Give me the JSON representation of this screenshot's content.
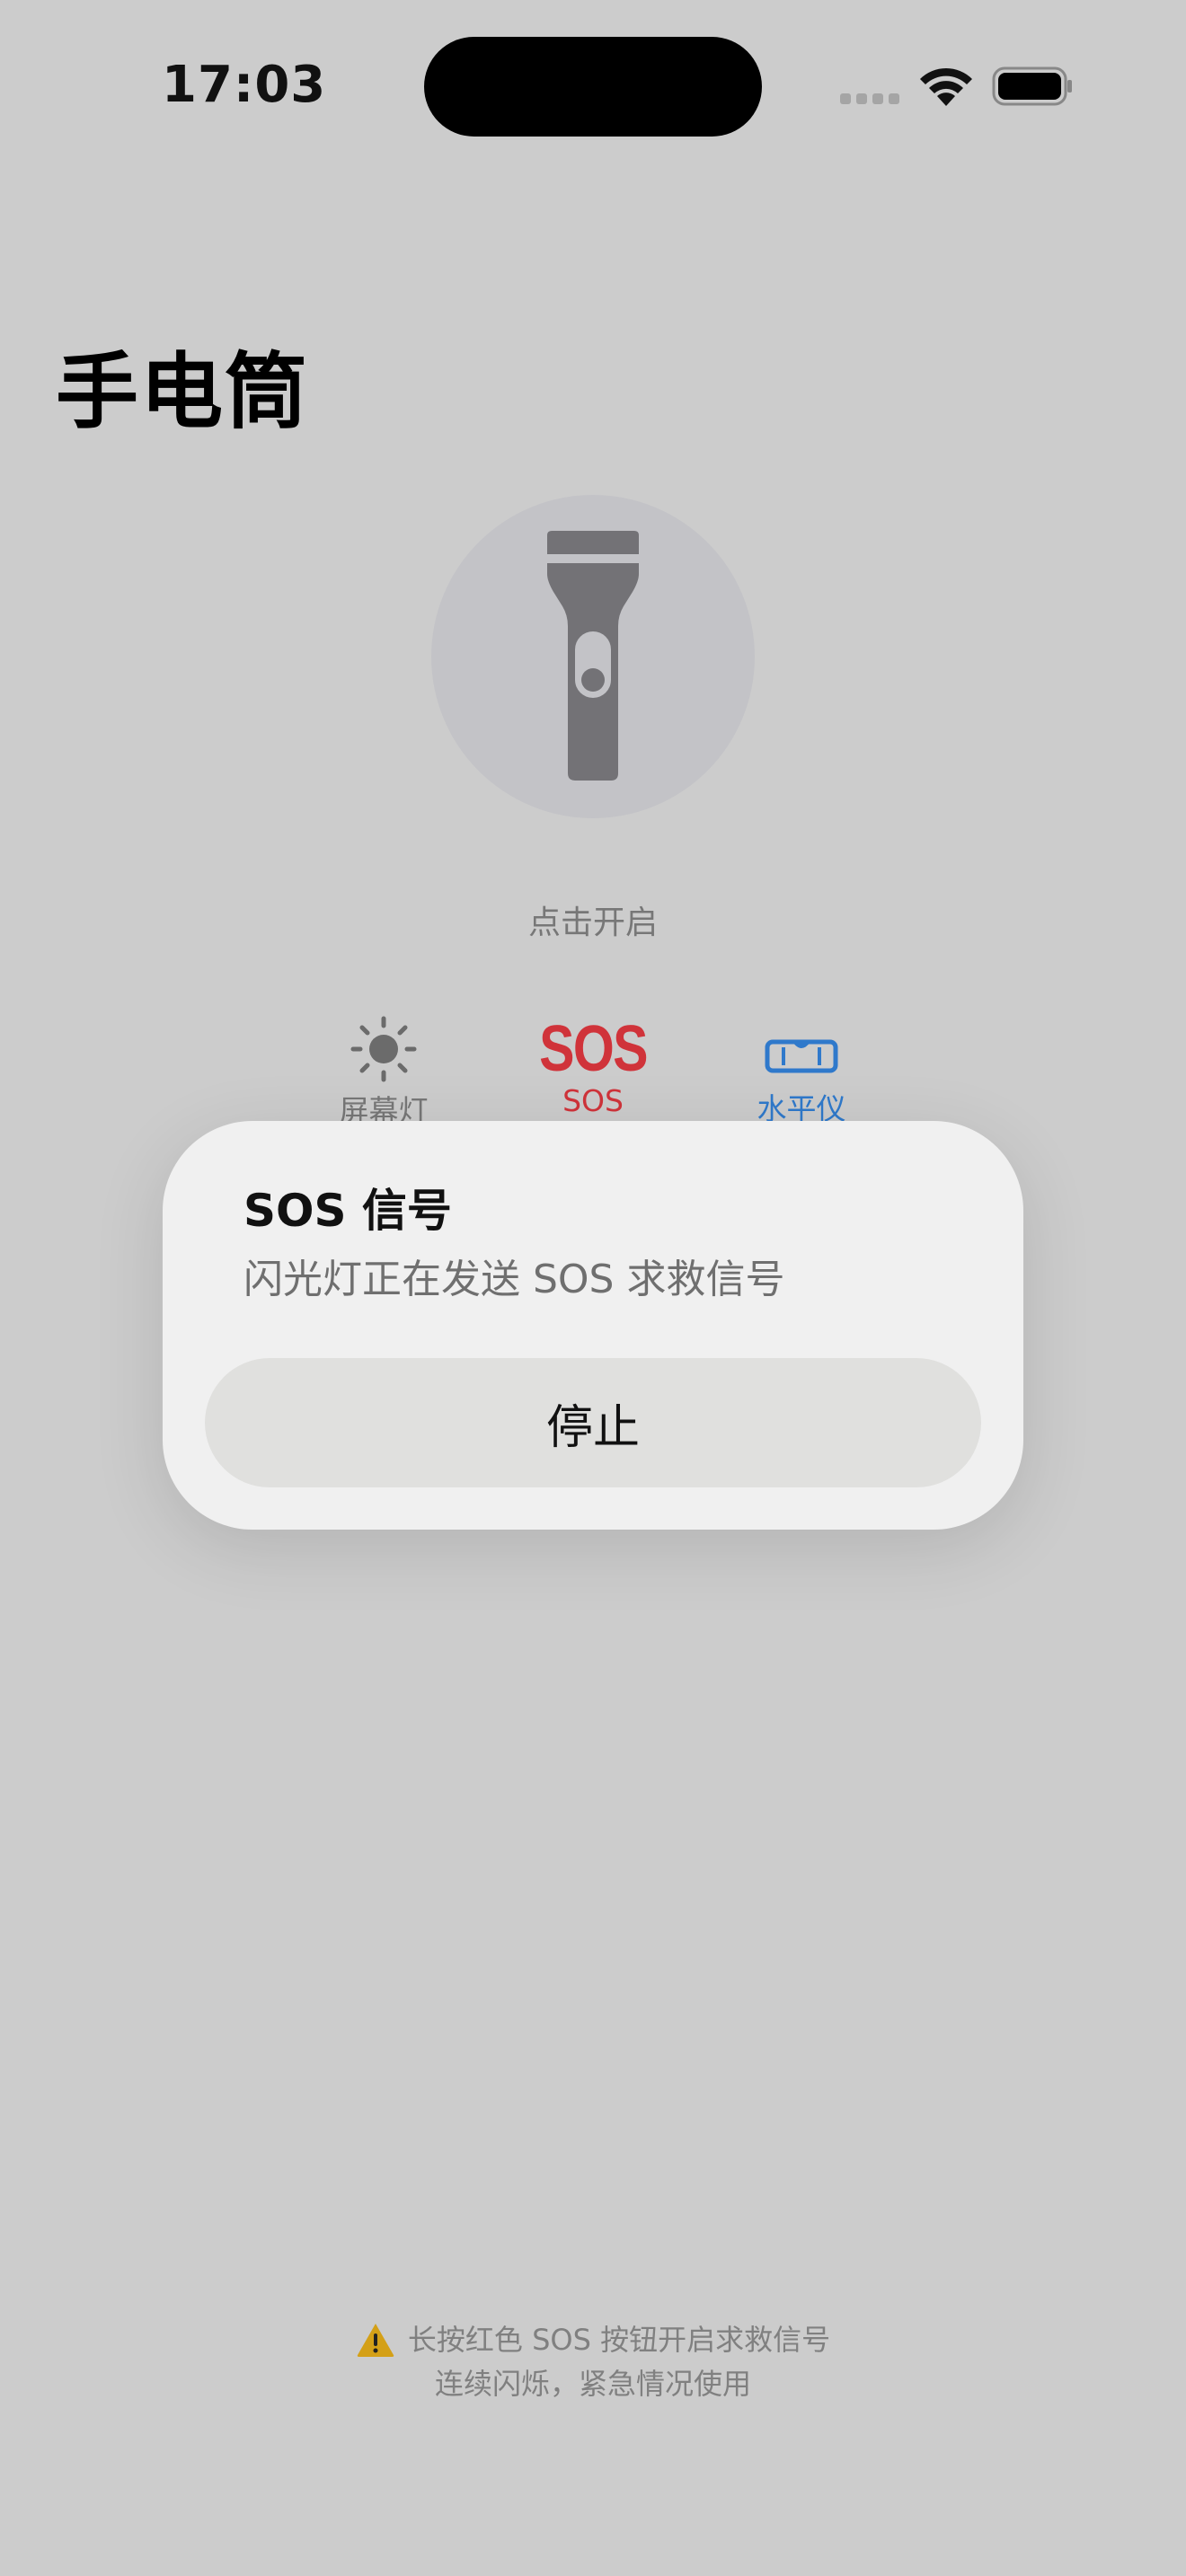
{
  "status_bar": {
    "time": "17:03"
  },
  "page": {
    "title": "手电筒"
  },
  "torch": {
    "hint": "点击开启"
  },
  "modes": {
    "screen_light": {
      "label": "屏幕灯",
      "icon": "sun-icon"
    },
    "sos": {
      "glyph": "SOS",
      "label": "SOS",
      "color": "#d0333a"
    },
    "level": {
      "label": "水平仪",
      "icon": "level-icon",
      "color": "#2f79cb"
    }
  },
  "alert": {
    "title": "SOS 信号",
    "message": "闪光灯正在发送 SOS 求救信号",
    "stop_label": "停止"
  },
  "footer": {
    "line1": "长按红色 SOS 按钮开启求救信号",
    "line2": "连续闪烁，紧急情况使用",
    "icon": "warning-icon"
  }
}
